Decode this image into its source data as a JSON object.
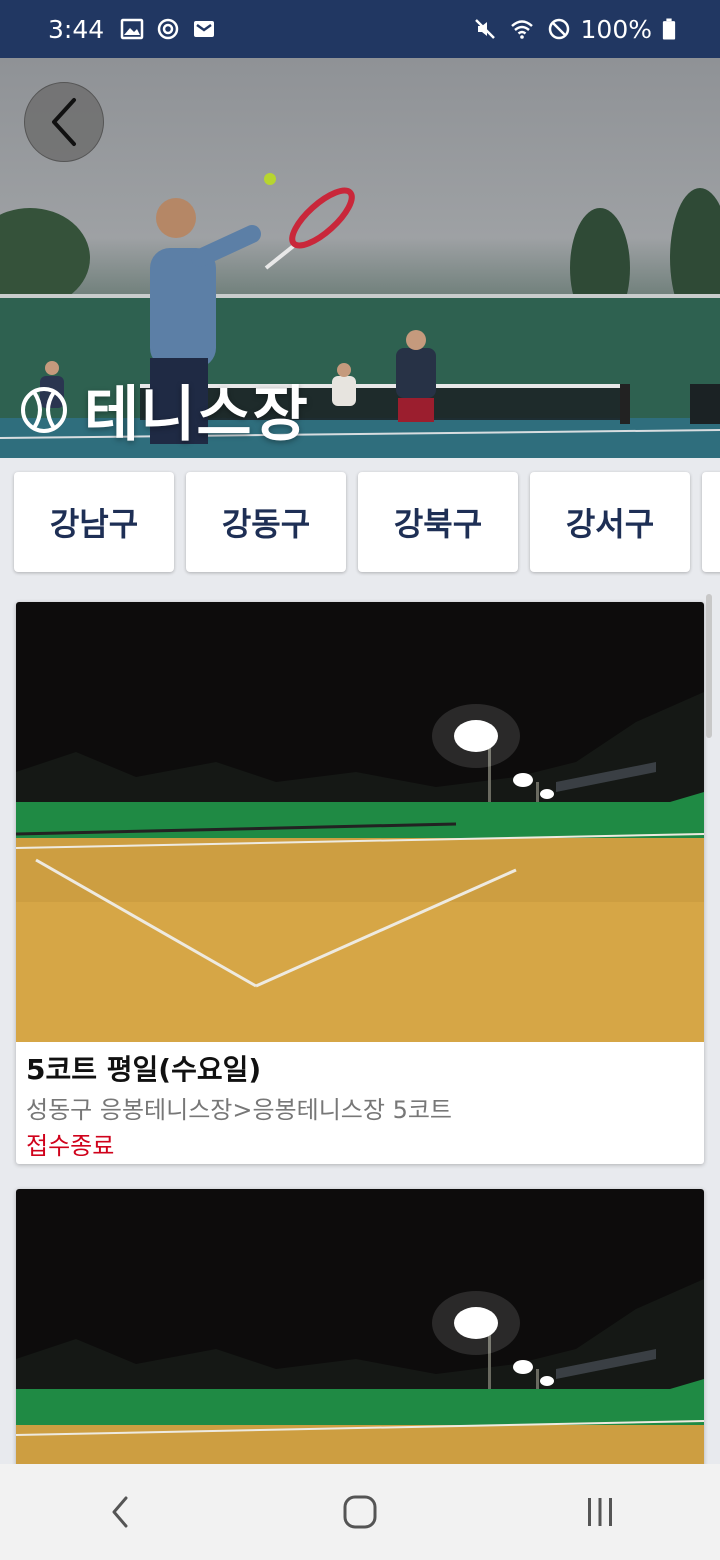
{
  "status_bar": {
    "time": "3:44",
    "battery": "100%",
    "left_icons": [
      "image-icon",
      "sync-icon",
      "mail-icon"
    ],
    "right_icons": [
      "mute-icon",
      "wifi-icon",
      "dnd-icon",
      "battery-icon"
    ]
  },
  "hero": {
    "title": "테니스장",
    "icon": "tennis-ball-icon",
    "back_icon": "chevron-left-icon"
  },
  "districts": [
    "강남구",
    "강동구",
    "강북구",
    "강서구"
  ],
  "cards": [
    {
      "title": "5코트 평일(수요일)",
      "subtitle": "성동구 응봉테니스장>응봉테니스장 5코트",
      "status": "접수종료",
      "status_color": "#d0021b"
    },
    {
      "title": "",
      "subtitle": "",
      "status": ""
    }
  ],
  "nav_bar": {
    "buttons": [
      "back-icon",
      "home-icon",
      "recents-icon"
    ]
  },
  "colors": {
    "status_bar_bg": "#213762",
    "chip_text": "#1e2f55",
    "status_red": "#d0021b"
  }
}
